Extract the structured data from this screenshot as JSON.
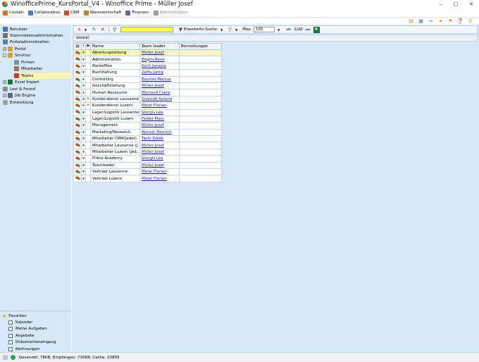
{
  "window": {
    "title": "WinofficePrime_KursPortal_V4 - Winoffice Prime - Müller Josef",
    "controls": [
      "minimize-icon",
      "maximize-icon",
      "close-icon"
    ]
  },
  "menu": [
    {
      "label": "Cockpit",
      "icon": "cockpit-icon",
      "color": "#e07020",
      "enabled": true
    },
    {
      "label": "Collaboration",
      "icon": "people-icon",
      "color": "#5a7ab0",
      "enabled": true
    },
    {
      "label": "CRM",
      "icon": "crm-grid-icon",
      "color": "#d04a30",
      "enabled": true
    },
    {
      "label": "Warenwirtschaft",
      "icon": "warehouse-icon",
      "color": "#b08a40",
      "enabled": true
    },
    {
      "label": "Finanzen",
      "icon": "finance-icon",
      "color": "#6a6a8a",
      "enabled": true
    },
    {
      "label": "Administration",
      "icon": "wrench-icon",
      "color": "#a0a0a0",
      "enabled": false
    }
  ],
  "top_right_icons": [
    "folder-up-icon",
    "calendar-icon",
    "link-icon",
    "star-icon",
    "bell-icon",
    "help-icon",
    "key-icon"
  ],
  "sidebar": {
    "items": [
      {
        "label": "Benutzer",
        "icon": "user-icon",
        "indent": 0,
        "expander": ""
      },
      {
        "label": "Stammdatenadministration",
        "icon": "database-icon",
        "indent": 0,
        "expander": ""
      },
      {
        "label": "Portaladministration",
        "icon": "portal-icon",
        "indent": 0,
        "expander": ""
      },
      {
        "label": "Portal",
        "icon": "folder-icon",
        "indent": 0,
        "expander": "+"
      },
      {
        "label": "Struktur",
        "icon": "folder-icon",
        "indent": 0,
        "expander": "-"
      },
      {
        "label": "Firmen",
        "icon": "company-icon",
        "indent": 1,
        "expander": ""
      },
      {
        "label": "Mitarbeiter",
        "icon": "employee-icon",
        "indent": 1,
        "expander": ""
      },
      {
        "label": "Teams",
        "icon": "team-icon",
        "indent": 1,
        "expander": ""
      },
      {
        "label": "Excel Import",
        "icon": "excel-icon",
        "indent": 0,
        "expander": "+"
      },
      {
        "label": "Lost & Found",
        "icon": "lost-found-icon",
        "indent": 0,
        "expander": ""
      },
      {
        "label": "Job Engine",
        "icon": "job-engine-icon",
        "indent": 0,
        "expander": "+"
      },
      {
        "label": "Entwicklung",
        "icon": "development-icon",
        "indent": 0,
        "expander": ""
      }
    ],
    "selected": "Teams"
  },
  "favorites": {
    "title": "Favoriten",
    "items": [
      "Kalender",
      "Meine Aufgaben",
      "Angebote",
      "Dokumenteneingang",
      "Rechnungen"
    ]
  },
  "toolbar": {
    "search_value": "",
    "advanced_search": "Erweiterte Suche",
    "max_label": "Max.",
    "max_value": "100",
    "page_indicator": "1/20"
  },
  "group_bar": {
    "text": "(keine)"
  },
  "table": {
    "columns": [
      "Name",
      "Team leader",
      "Bemerkungen"
    ],
    "rows": [
      {
        "name": "Abteilungsleitung",
        "leader": "Müller Josef",
        "flag": false,
        "selected": true
      },
      {
        "name": "Administration",
        "leader": "Böglin René",
        "flag": false,
        "selected": false
      },
      {
        "name": "Backoffice",
        "leader": "Koch Janaica",
        "flag": false,
        "selected": false
      },
      {
        "name": "Buchhaltung",
        "leader": "Zeffa Janny",
        "flag": false,
        "selected": false
      },
      {
        "name": "Controlling",
        "leader": "Bourret Marcus",
        "flag": false,
        "selected": false
      },
      {
        "name": "Geschäftsleitung",
        "leader": "Müller Josef",
        "flag": false,
        "selected": false
      },
      {
        "name": "Human Ressource",
        "leader": "Michaud Claire",
        "flag": false,
        "selected": false
      },
      {
        "name": "Kundendienst Lausanne",
        "leader": "Schmidt Roland",
        "flag": true,
        "selected": false
      },
      {
        "name": "Kundendienst Luzern",
        "leader": "Meier Florian",
        "flag": true,
        "selected": false
      },
      {
        "name": "Lager/Logistik Lausanne",
        "leader": "Giorgis Léa",
        "flag": false,
        "selected": false
      },
      {
        "name": "Lager/Logistik Luzern",
        "leader": "Felder Marc",
        "flag": false,
        "selected": false
      },
      {
        "name": "Management",
        "leader": "Müller Josef",
        "flag": false,
        "selected": false
      },
      {
        "name": "Marketing/Research",
        "leader": "Amrein Henrich",
        "flag": false,
        "selected": false
      },
      {
        "name": "Mitarbeiter CRM(Jeder)",
        "leader": "Tashi Dolek",
        "flag": false,
        "selected": false
      },
      {
        "name": "Mitarbeiter Lausanne (J...",
        "leader": "Müller Josef",
        "flag": false,
        "selected": false
      },
      {
        "name": "Mitarbeiter Luzern (Jed...",
        "leader": "Müller Josef",
        "flag": false,
        "selected": false
      },
      {
        "name": "Prime Academy",
        "leader": "Giorgis Léa",
        "flag": false,
        "selected": false
      },
      {
        "name": "Teamleader",
        "leader": "Müller Josef",
        "flag": false,
        "selected": false
      },
      {
        "name": "Vertrieb Lausanne",
        "leader": "Meier Florian",
        "flag": false,
        "selected": false
      },
      {
        "name": "Vertrieb Luzern",
        "leader": "Meier Florian",
        "flag": false,
        "selected": false
      }
    ]
  },
  "status": {
    "text": "Gesendet: 78KB, Empfangen: 739KB, Cache: 23805"
  }
}
